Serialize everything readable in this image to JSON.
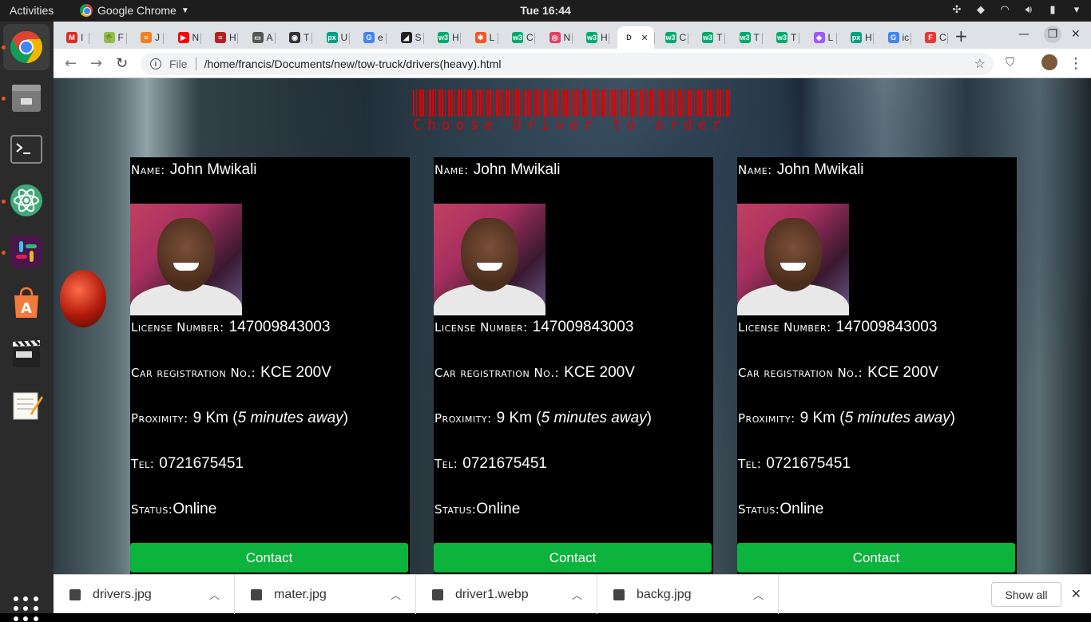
{
  "system": {
    "activities": "Activities",
    "app_name": "Google Chrome",
    "clock": "Tue 16:44"
  },
  "dock": {
    "items": [
      "chrome-icon",
      "files-icon",
      "terminal-icon",
      "atom-icon",
      "slack-icon",
      "software-center-icon",
      "video-editor-icon",
      "text-editor-icon",
      "show-apps-icon"
    ]
  },
  "browser": {
    "tabs": [
      {
        "fav": "M",
        "label": "I",
        "color": "#d93025"
      },
      {
        "fav": "🌴",
        "label": "F",
        "color": "#8bc34a"
      },
      {
        "fav": "≡",
        "label": "J",
        "color": "#f48024"
      },
      {
        "fav": "▶",
        "label": "N",
        "color": "#ff0000"
      },
      {
        "fav": "≈",
        "label": "H",
        "color": "#b22222"
      },
      {
        "fav": "▭",
        "label": "A",
        "color": "#555555"
      },
      {
        "fav": "◉",
        "label": "T",
        "color": "#333333"
      },
      {
        "fav": "px",
        "label": "U",
        "color": "#05a081"
      },
      {
        "fav": "G",
        "label": "e",
        "color": "#4285f4"
      },
      {
        "fav": "◢",
        "label": "S",
        "color": "#222222"
      },
      {
        "fav": "w3",
        "label": "H",
        "color": "#04aa6d"
      },
      {
        "fav": "✱",
        "label": "L",
        "color": "#f35626"
      },
      {
        "fav": "w3",
        "label": "C",
        "color": "#04aa6d"
      },
      {
        "fav": "◎",
        "label": "N",
        "color": "#e4405f"
      },
      {
        "fav": "w3",
        "label": "H",
        "color": "#04aa6d"
      },
      {
        "fav": "D",
        "label": "",
        "color": "#ffffff"
      },
      {
        "fav": "w3",
        "label": "C",
        "color": "#04aa6d"
      },
      {
        "fav": "w3",
        "label": "T",
        "color": "#04aa6d"
      },
      {
        "fav": "w3",
        "label": "T",
        "color": "#04aa6d"
      },
      {
        "fav": "w3",
        "label": "T",
        "color": "#04aa6d"
      },
      {
        "fav": "◆",
        "label": "L",
        "color": "#a259ff"
      },
      {
        "fav": "px",
        "label": "H",
        "color": "#05a081"
      },
      {
        "fav": "G",
        "label": "ic",
        "color": "#4285f4"
      },
      {
        "fav": "F",
        "label": "C",
        "color": "#e53935"
      }
    ],
    "scheme_label": "File",
    "url": "/home/francis/Documents/new/tow-truck/drivers(heavy).html"
  },
  "page": {
    "title": "Choose Driver to order",
    "drivers": [
      {
        "name_label": "Name:",
        "name": "John Mwikali",
        "license_label": "License Number:",
        "license": "147009843003",
        "reg_label": "Car registration No.:",
        "reg": "KCE 200V",
        "proximity_label": "Proximity:",
        "proximity_km": "9 Km",
        "proximity_time": "5 minutes away",
        "tel_label": "Tel:",
        "tel": "0721675451",
        "status_label": "Status:",
        "status": "Online",
        "button": "Contact"
      },
      {
        "name_label": "Name:",
        "name": "John Mwikali",
        "license_label": "License Number:",
        "license": "147009843003",
        "reg_label": "Car registration No.:",
        "reg": "KCE 200V",
        "proximity_label": "Proximity:",
        "proximity_km": "9 Km",
        "proximity_time": "5 minutes away",
        "tel_label": "Tel:",
        "tel": "0721675451",
        "status_label": "Status:",
        "status": "Online",
        "button": "Contact"
      },
      {
        "name_label": "Name:",
        "name": "John Mwikali",
        "license_label": "License Number:",
        "license": "147009843003",
        "reg_label": "Car registration No.:",
        "reg": "KCE 200V",
        "proximity_label": "Proximity:",
        "proximity_km": "9 Km",
        "proximity_time": "5 minutes away",
        "tel_label": "Tel:",
        "tel": "0721675451",
        "status_label": "Status:",
        "status": "Online",
        "button": "Contact"
      }
    ]
  },
  "downloads": {
    "items": [
      "drivers.jpg",
      "mater.jpg",
      "driver1.webp",
      "backg.jpg"
    ],
    "show_all": "Show all"
  },
  "colors": {
    "title_red": "#e00000",
    "contact_green": "#0cb33c",
    "card_bg": "#000000"
  }
}
